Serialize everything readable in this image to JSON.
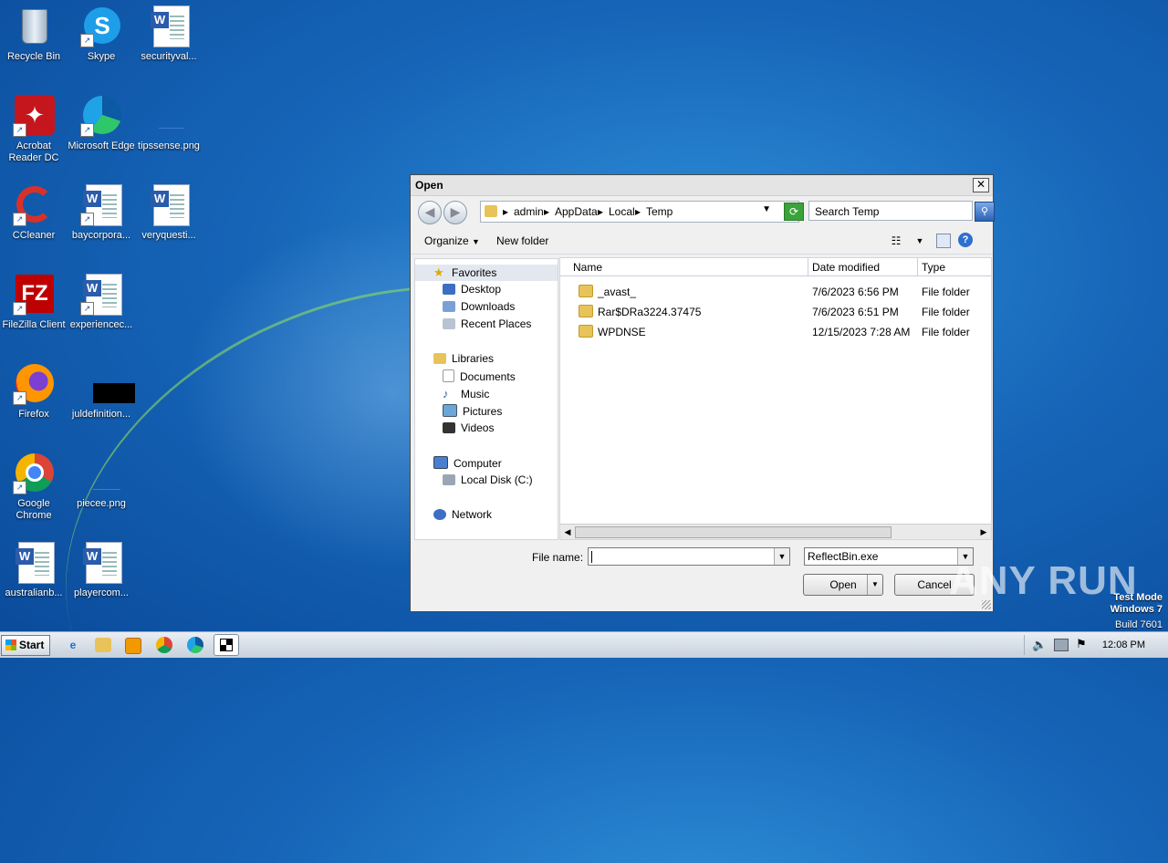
{
  "desktop": {
    "icons": [
      {
        "label": "Recycle Bin"
      },
      {
        "label": "Skype"
      },
      {
        "label": "securityval..."
      },
      {
        "label": "Acrobat Reader DC"
      },
      {
        "label": "Microsoft Edge"
      },
      {
        "label": "tipssense.png"
      },
      {
        "label": "CCleaner"
      },
      {
        "label": "baycorpora..."
      },
      {
        "label": "veryquesti..."
      },
      {
        "label": "FileZilla Client"
      },
      {
        "label": "experiencec..."
      },
      {
        "label": "Firefox"
      },
      {
        "label": "juldefinition..."
      },
      {
        "label": "Google Chrome"
      },
      {
        "label": "piecee.png"
      },
      {
        "label": "australianb..."
      },
      {
        "label": "playercom..."
      }
    ]
  },
  "dialog": {
    "title": "Open",
    "close_glyph": "✕",
    "breadcrumb": [
      "admin",
      "AppData",
      "Local",
      "Temp"
    ],
    "search_placeholder": "Search Temp",
    "toolbar": {
      "organize": "Organize",
      "new_folder": "New folder"
    },
    "nav": {
      "favorites": "Favorites",
      "desktop": "Desktop",
      "downloads": "Downloads",
      "recent": "Recent Places",
      "libraries": "Libraries",
      "documents": "Documents",
      "music": "Music",
      "pictures": "Pictures",
      "videos": "Videos",
      "computer": "Computer",
      "local_disk": "Local Disk (C:)",
      "network": "Network"
    },
    "columns": {
      "name": "Name",
      "date": "Date modified",
      "type": "Type"
    },
    "files": [
      {
        "name": "_avast_",
        "date": "7/6/2023 6:56 PM",
        "type": "File folder"
      },
      {
        "name": "Rar$DRa3224.37475",
        "date": "7/6/2023 6:51 PM",
        "type": "File folder"
      },
      {
        "name": "WPDNSE",
        "date": "12/15/2023 7:28 AM",
        "type": "File folder"
      }
    ],
    "file_name_label": "File name:",
    "file_name_value": "",
    "filter": "ReflectBin.exe",
    "open_button": "Open",
    "cancel_button": "Cancel"
  },
  "taskbar": {
    "start": "Start",
    "clock": "12:08 PM"
  },
  "watermark": {
    "line1": "Test Mode",
    "line2": "Windows 7",
    "line3": "Build 7601",
    "brand": "ANY RUN"
  }
}
